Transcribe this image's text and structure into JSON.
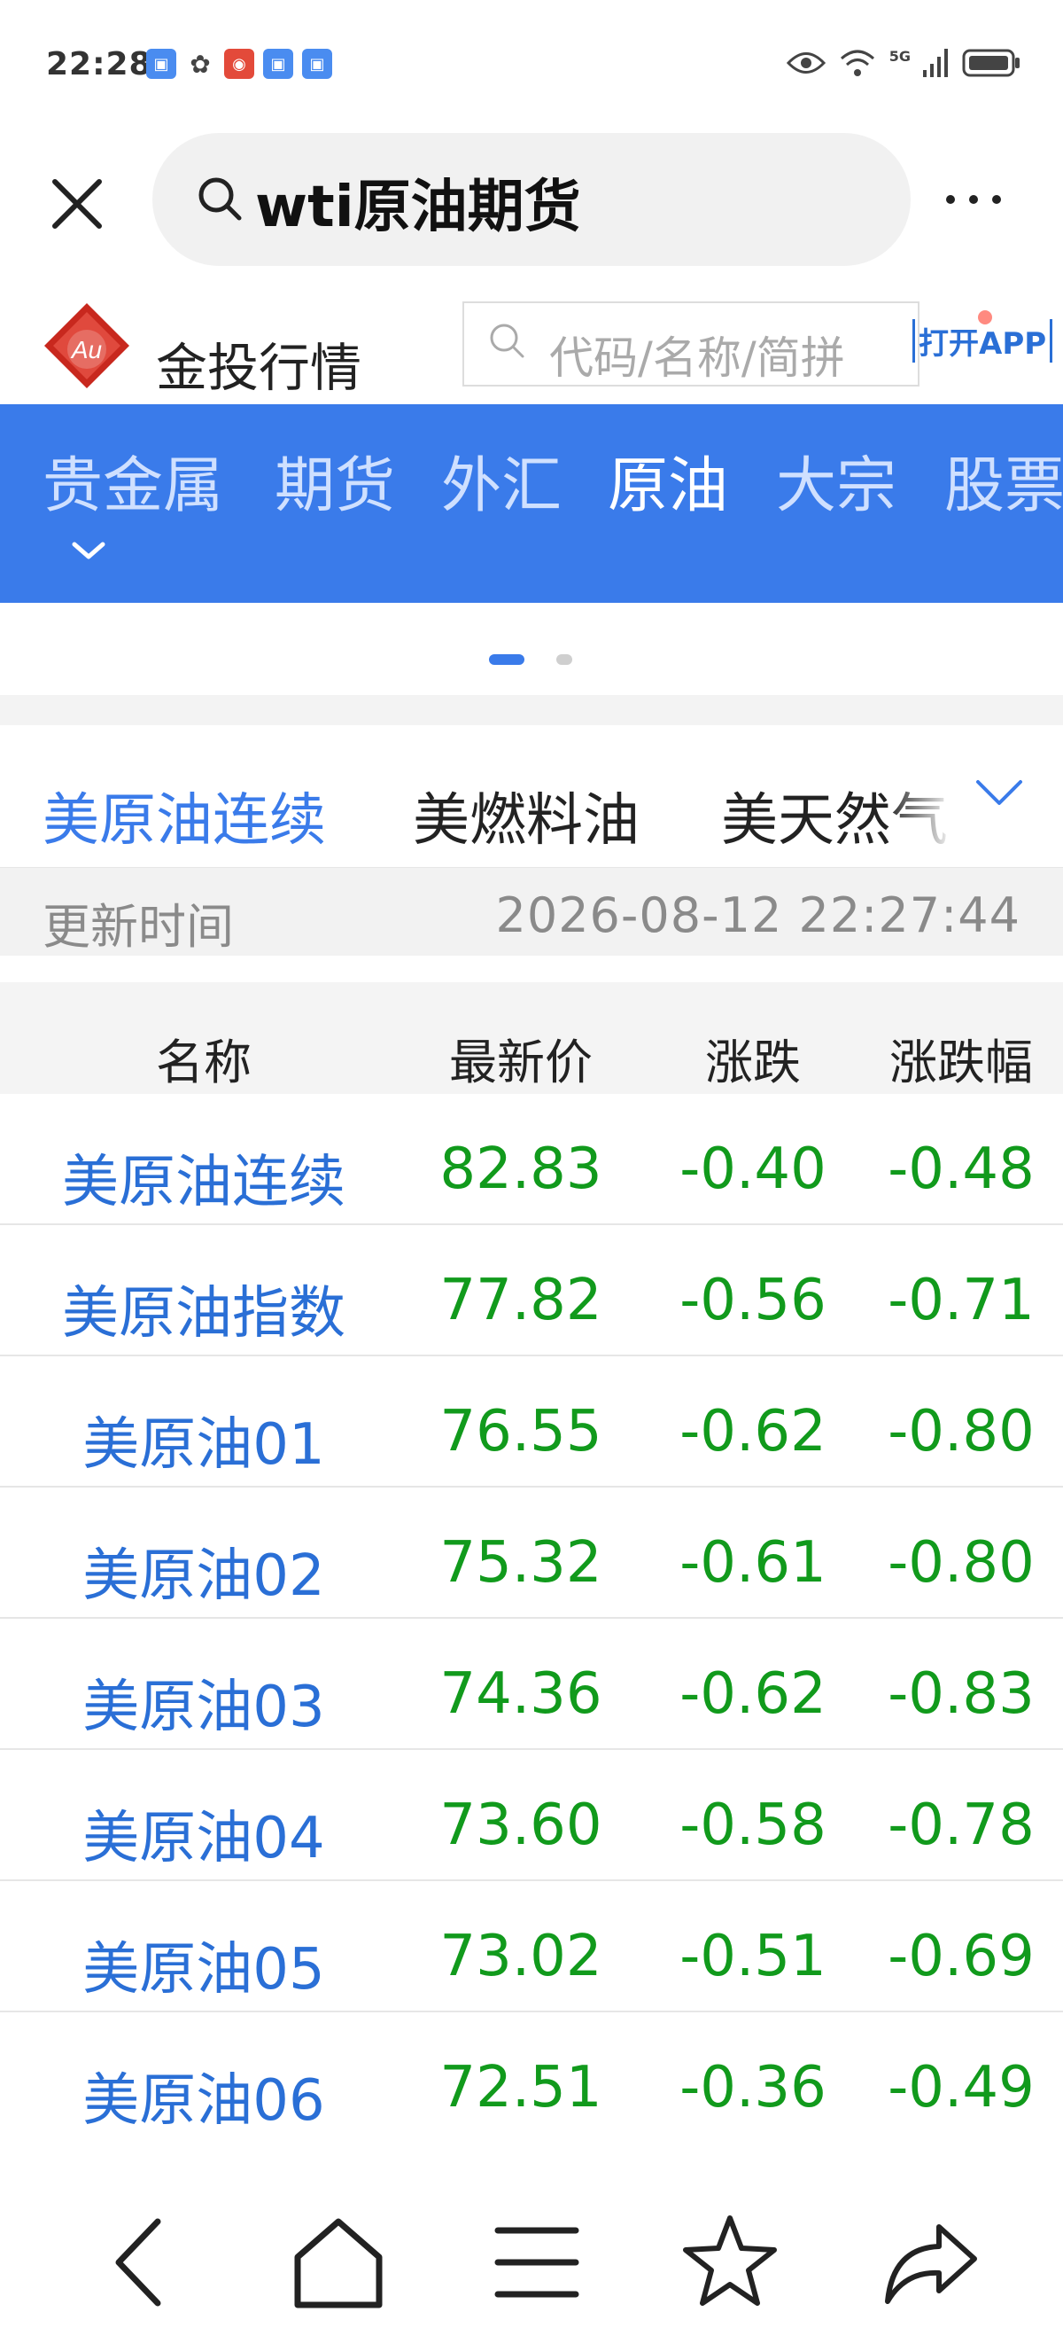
{
  "status_bar": {
    "time": "22:28",
    "network": "5G",
    "app_icons": [
      "app-icon",
      "wechat-icon",
      "app-icon",
      "app-icon",
      "app-icon"
    ]
  },
  "search": {
    "query": "wti原油期货"
  },
  "site": {
    "logo_text": "Au",
    "name": "金投行情",
    "search_placeholder": "代码/名称/简拼",
    "open_app": "打开APP"
  },
  "nav": {
    "items": [
      {
        "label": "贵金属",
        "active": false
      },
      {
        "label": "期货",
        "active": false
      },
      {
        "label": "外汇",
        "active": false
      },
      {
        "label": "原油",
        "active": true
      },
      {
        "label": "大宗",
        "active": false
      },
      {
        "label": "股票",
        "active": false
      }
    ]
  },
  "tabs": {
    "items": [
      {
        "label": "美原油连续",
        "active": true
      },
      {
        "label": "美燃料油",
        "active": false
      },
      {
        "label": "美天然气",
        "active": false
      }
    ]
  },
  "update": {
    "label": "更新时间",
    "time": "2026-08-12 22:27:44"
  },
  "table": {
    "headers": {
      "name": "名称",
      "price": "最新价",
      "change": "涨跌",
      "pct": "涨跌幅"
    },
    "rows": [
      {
        "name": "美原油连续",
        "price": "82.83",
        "change": "-0.40",
        "pct": "-0.48"
      },
      {
        "name": "美原油指数",
        "price": "77.82",
        "change": "-0.56",
        "pct": "-0.71"
      },
      {
        "name": "美原油01",
        "price": "76.55",
        "change": "-0.62",
        "pct": "-0.80"
      },
      {
        "name": "美原油02",
        "price": "75.32",
        "change": "-0.61",
        "pct": "-0.80"
      },
      {
        "name": "美原油03",
        "price": "74.36",
        "change": "-0.62",
        "pct": "-0.83"
      },
      {
        "name": "美原油04",
        "price": "73.60",
        "change": "-0.58",
        "pct": "-0.78"
      },
      {
        "name": "美原油05",
        "price": "73.02",
        "change": "-0.51",
        "pct": "-0.69"
      },
      {
        "name": "美原油06",
        "price": "72.51",
        "change": "-0.36",
        "pct": "-0.49"
      }
    ]
  },
  "colors": {
    "accent": "#3a7bea",
    "link": "#2a6fd6",
    "down": "#119a1c"
  }
}
